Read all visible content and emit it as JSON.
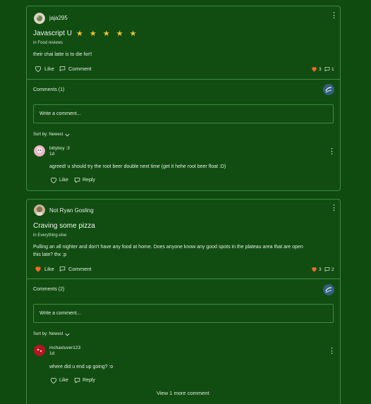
{
  "posts": [
    {
      "author": "jaja295",
      "title": "Javascript U",
      "rating": 5,
      "stars": "★ ★ ★ ★ ★",
      "category": "in Food reviews",
      "body": "their chai latte is to die for!!",
      "like_label": "Like",
      "comment_label": "Comment",
      "like_count": "3",
      "comment_count": "1",
      "comments_header": "Comments (1)",
      "comment_placeholder": "Write a comment...",
      "sort_label": "Sort by: Newest",
      "comments": [
        {
          "author": "billyboy :3",
          "time": "1d",
          "body": "agreed! u should try the root beer double next time (get it hehe root beer float :D)",
          "like_label": "Like",
          "reply_label": "Reply"
        }
      ]
    },
    {
      "author": "Not Ryan Gosling",
      "title": "Craving some pizza",
      "category": "in Everything else",
      "body_line1": "Pulling an all nighter and don't have any food at home. Does anyone know any good spots in the plateau area that are open",
      "body_line2": "this late? thx :p",
      "like_label": "Like",
      "comment_label": "Comment",
      "like_count": "3",
      "comment_count": "2",
      "comments_header": "Comments (2)",
      "comment_placeholder": "Write a comment...",
      "sort_label": "Sort by: Newest",
      "comments": [
        {
          "author": "mchaxluver123",
          "time": "1d",
          "body": "where did u end up going? :o",
          "like_label": "Like",
          "reply_label": "Reply"
        }
      ],
      "view_more": "View 1 more comment"
    }
  ],
  "colors": {
    "background": "#0f4a0f",
    "border": "#3f8a3f",
    "heart_liked": "#f06a2a",
    "star": "#f2c23a"
  },
  "icons": [
    "kebab-menu-icon",
    "heart-icon",
    "speech-bubble-icon",
    "comment-badge-icon",
    "chevron-down-icon",
    "reply-icon"
  ]
}
